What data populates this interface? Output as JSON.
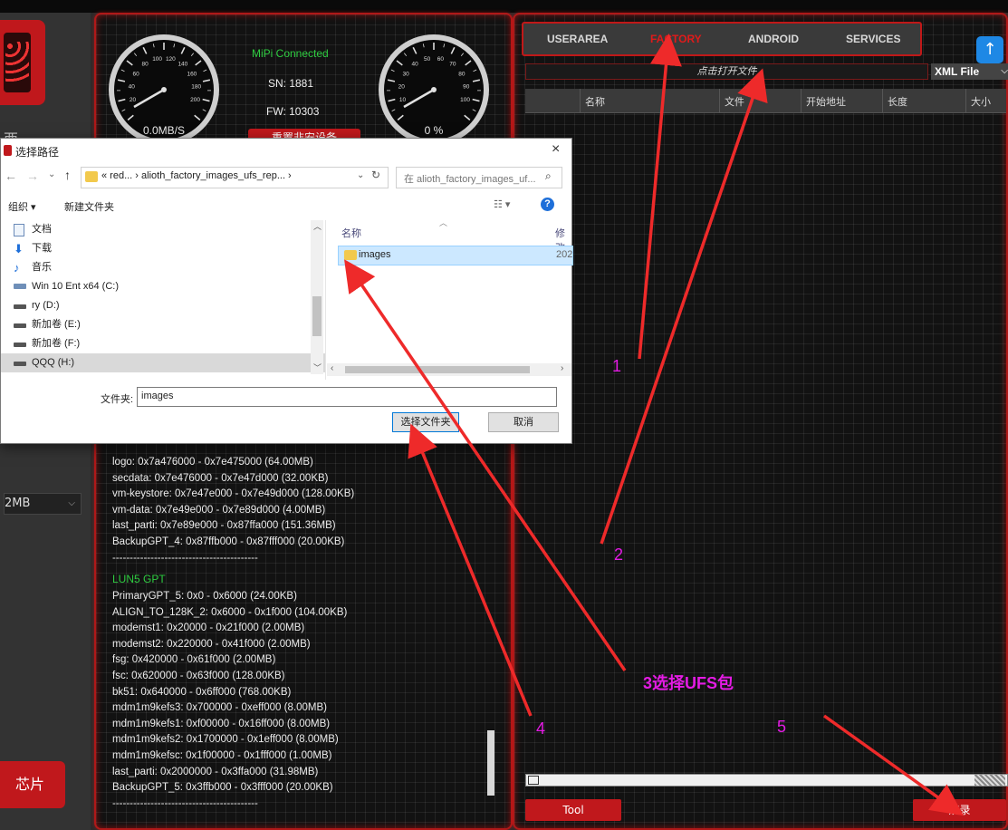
{
  "left": {
    "partial_label": "西",
    "size_dropdown": "2MB",
    "chip_button": "芯片"
  },
  "status": {
    "mipi": "MiPi Connected",
    "sn": "SN: 1881",
    "fw": "FW: 10303",
    "speed": "0.0MB/S",
    "percent": "0 %",
    "reset_button": "重置非安设备",
    "gauge_left_ticks": [
      "20",
      "40",
      "60",
      "80",
      "100",
      "120",
      "140",
      "160",
      "180",
      "200"
    ],
    "gauge_right_ticks": [
      "10",
      "20",
      "30",
      "40",
      "50",
      "60",
      "70",
      "80",
      "90",
      "100"
    ]
  },
  "log": {
    "lines_top": [
      "logo: 0x7a476000 - 0x7e475000 (64.00MB)",
      "secdata: 0x7e476000 - 0x7e47d000 (32.00KB)",
      "vm-keystore: 0x7e47e000 - 0x7e49d000 (128.00KB)",
      "vm-data: 0x7e49e000 - 0x7e89d000 (4.00MB)",
      "last_parti: 0x7e89e000 - 0x87ffa000 (151.36MB)",
      "BackupGPT_4: 0x87ffb000 - 0x87fff000 (20.00KB)",
      "------------------------------------------"
    ],
    "section_title": "LUN5 GPT",
    "lines_bottom": [
      "PrimaryGPT_5: 0x0 - 0x6000 (24.00KB)",
      "ALIGN_TO_128K_2: 0x6000 - 0x1f000 (104.00KB)",
      "modemst1: 0x20000 - 0x21f000 (2.00MB)",
      "modemst2: 0x220000 - 0x41f000 (2.00MB)",
      "fsg: 0x420000 - 0x61f000 (2.00MB)",
      "fsc: 0x620000 - 0x63f000 (128.00KB)",
      "bk51: 0x640000 - 0x6ff000 (768.00KB)",
      "mdm1m9kefs3: 0x700000 - 0xeff000 (8.00MB)",
      "mdm1m9kefs1: 0xf00000 - 0x16ff000 (8.00MB)",
      "mdm1m9kefs2: 0x1700000 - 0x1eff000 (8.00MB)",
      "mdm1m9kefsc: 0x1f00000 - 0x1fff000 (1.00MB)",
      "last_parti: 0x2000000 - 0x3ffa000 (31.98MB)",
      "BackupGPT_5: 0x3ffb000 - 0x3fff000 (20.00KB)",
      "------------------------------------------"
    ]
  },
  "right": {
    "tabs": [
      "USERAREA",
      "FACTORY",
      "ANDROID",
      "SERVICES"
    ],
    "open_file": "点击打开文件",
    "file_type": "XML File",
    "columns": [
      "名称",
      "文件",
      "开始地址",
      "长度",
      "大小"
    ],
    "tool_button": "Tool",
    "flash_button": "烧录"
  },
  "dialog": {
    "title": "选择路径",
    "breadcrumb": "« red...  ›  alioth_factory_images_ufs_rep...  ›",
    "search_placeholder": "在 alioth_factory_images_uf...",
    "organize": "组织 ▾",
    "new_folder": "新建文件夹",
    "nav_items": [
      "文档",
      "下载",
      "音乐",
      "Win 10 Ent x64 (C:)",
      "ry (D:)",
      "新加卷 (E:)",
      "新加卷 (F:)",
      "QQQ (H:)"
    ],
    "col_name": "名称",
    "col_modified": "修改",
    "file_name": "images",
    "file_date": "202",
    "folder_label": "文件夹:",
    "folder_value": "images",
    "select_button": "选择文件夹",
    "cancel_button": "取消"
  },
  "annotations": {
    "n1": "1",
    "n2": "2",
    "n3": "3选择UFS包",
    "n4": "4",
    "n5": "5"
  },
  "colors": {
    "accent_red": "#c0181c",
    "tab_active": "#e01a1a",
    "green": "#2ecc40",
    "magenta": "#e41be4"
  }
}
